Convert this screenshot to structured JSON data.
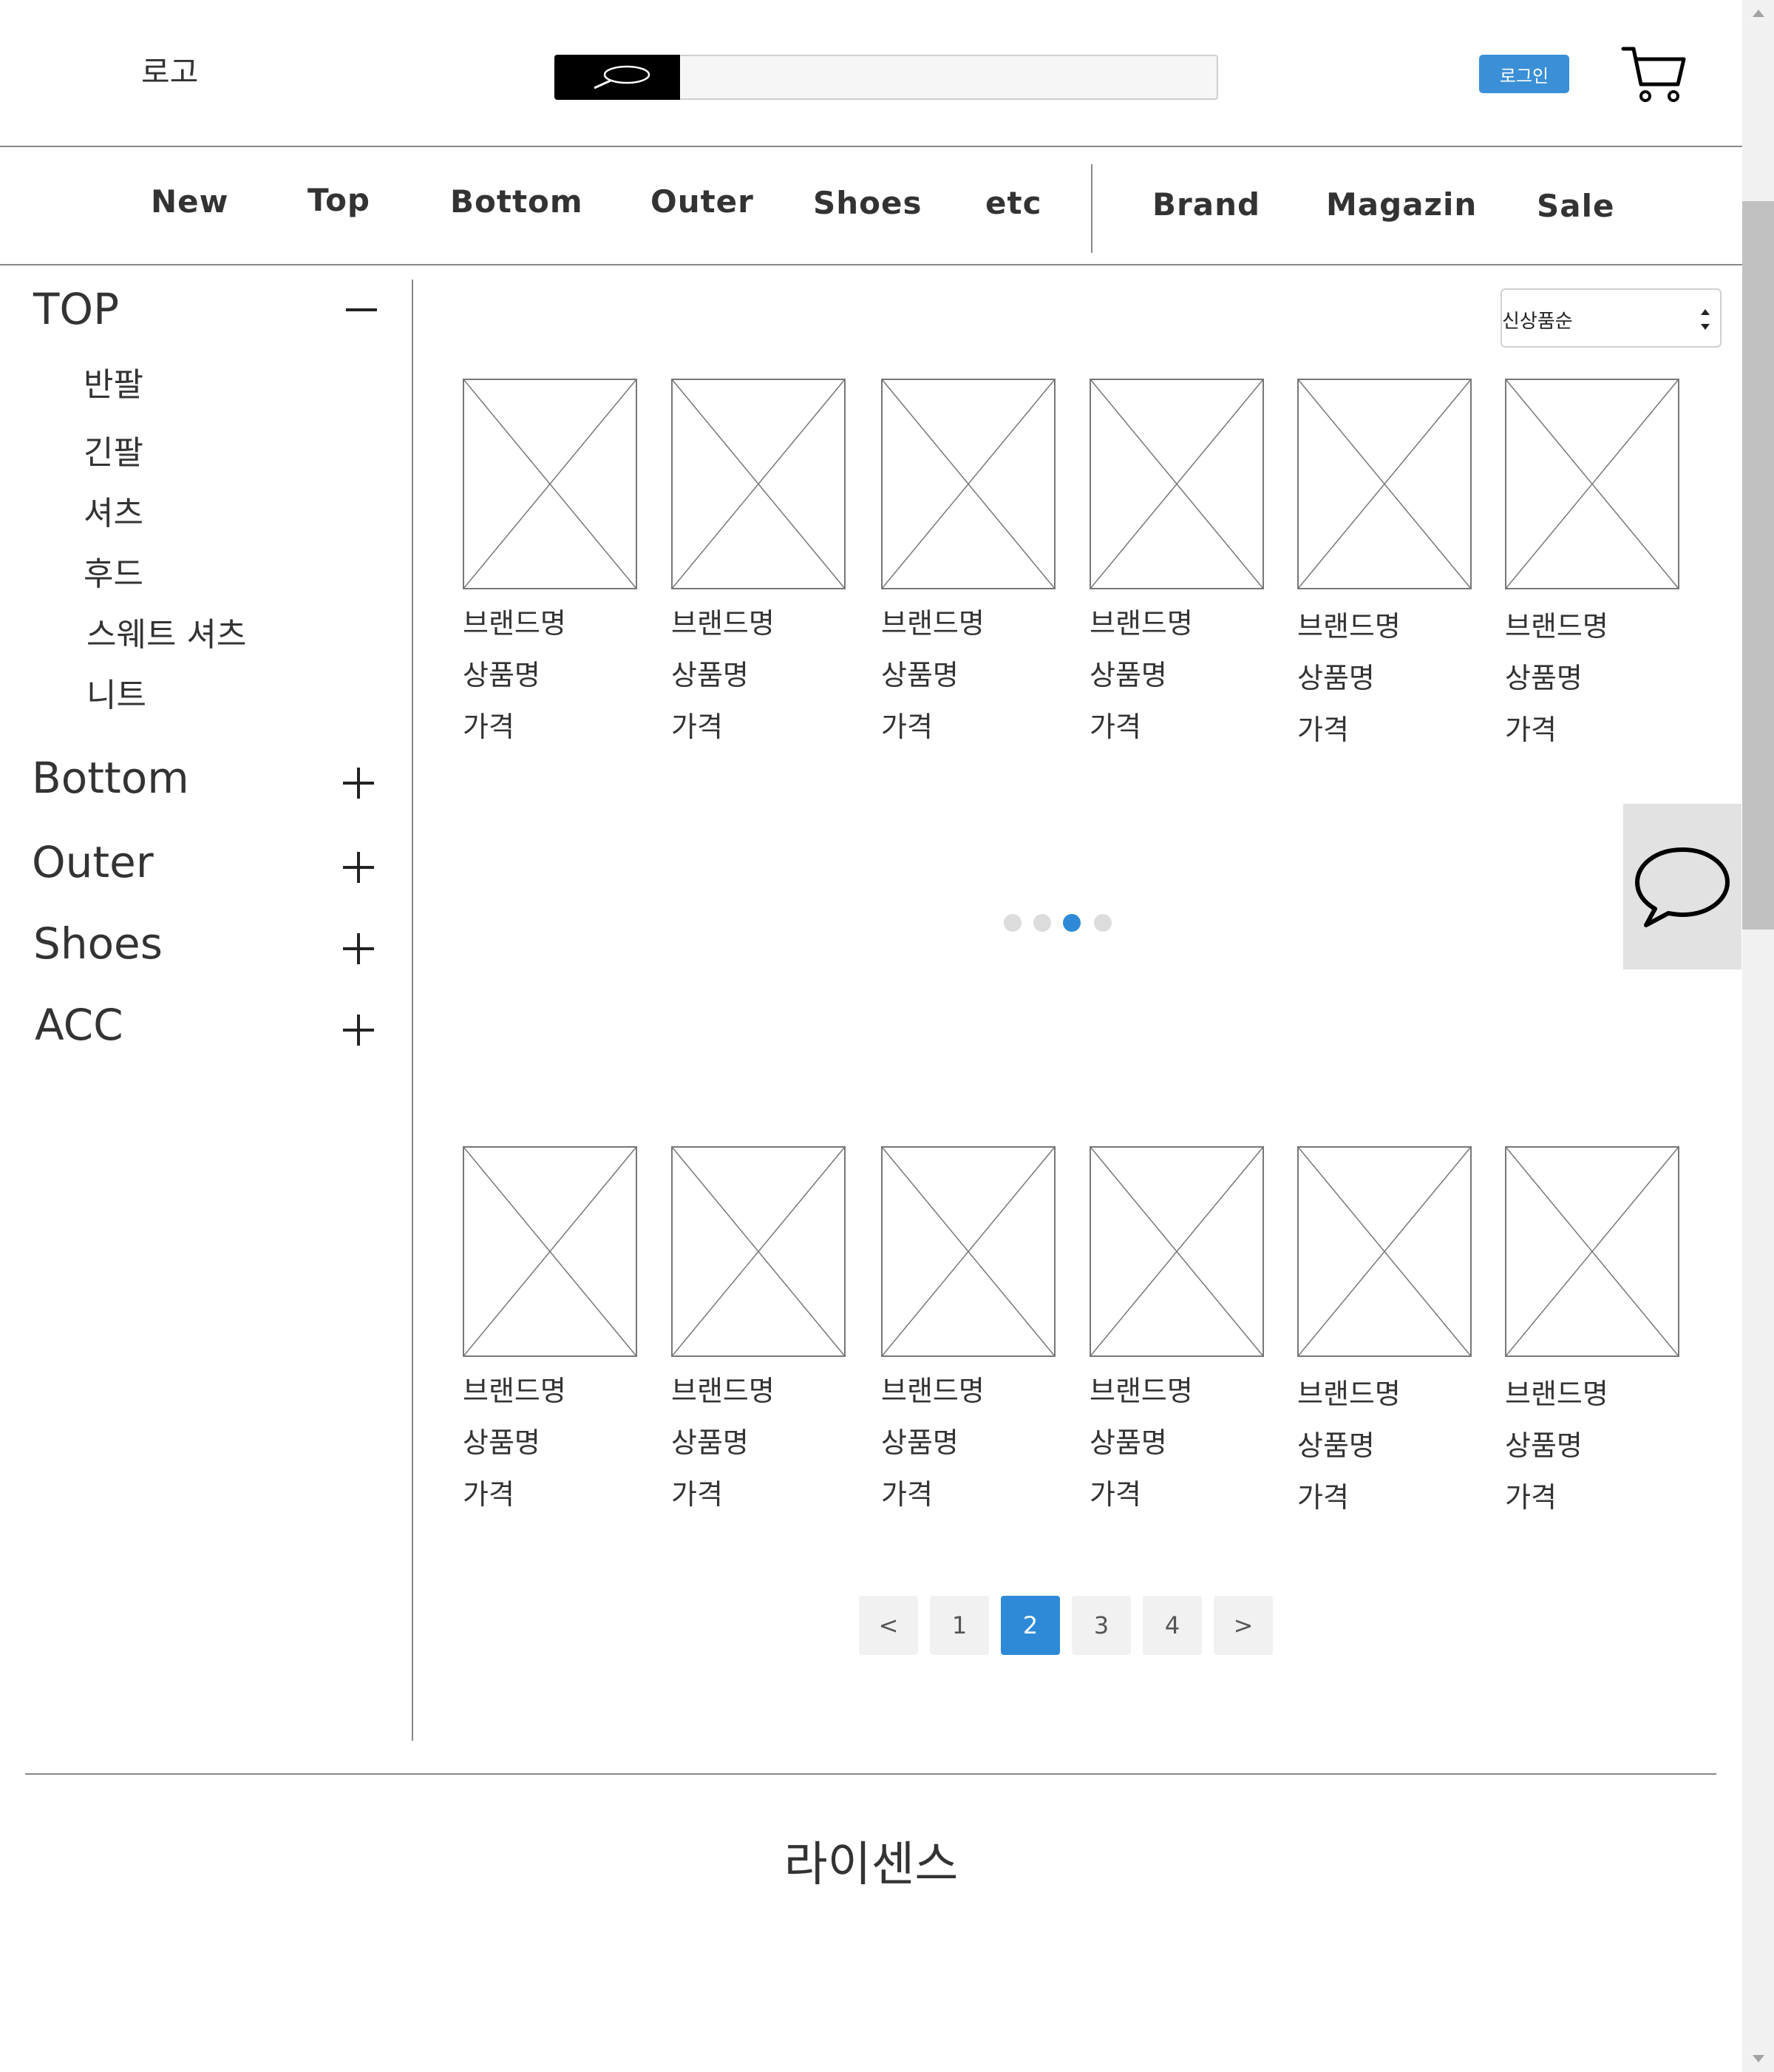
{
  "header": {
    "logo": "로고",
    "search_placeholder": "",
    "login_label": "로그인"
  },
  "nav": {
    "items": [
      "New",
      "Top",
      "Bottom",
      "Outer",
      "Shoes",
      "etc",
      "Brand",
      "Magazin",
      "Sale"
    ]
  },
  "sidebar": {
    "top": {
      "title": "TOP",
      "expanded": true,
      "sub_items": [
        "반팔",
        "긴팔",
        "셔츠",
        "후드",
        "스웨트 셔츠",
        "니트"
      ]
    },
    "categories": [
      "Bottom",
      "Outer",
      "Shoes",
      "ACC"
    ]
  },
  "sort": {
    "selected": "신상품순"
  },
  "products": {
    "row1": [
      {
        "brand": "브랜드명",
        "name": "상품명",
        "price": "가격"
      },
      {
        "brand": "브랜드명",
        "name": "상품명",
        "price": "가격"
      },
      {
        "brand": "브랜드명",
        "name": "상품명",
        "price": "가격"
      },
      {
        "brand": "브랜드명",
        "name": "상품명",
        "price": "가격"
      },
      {
        "brand": "브랜드명",
        "name": "상품명",
        "price": "가격"
      },
      {
        "brand": "브랜드명",
        "name": "상품명",
        "price": "가격"
      }
    ],
    "row2": [
      {
        "brand": "브랜드명",
        "name": "상품명",
        "price": "가격"
      },
      {
        "brand": "브랜드명",
        "name": "상품명",
        "price": "가격"
      },
      {
        "brand": "브랜드명",
        "name": "상품명",
        "price": "가격"
      },
      {
        "brand": "브랜드명",
        "name": "상품명",
        "price": "가격"
      },
      {
        "brand": "브랜드명",
        "name": "상품명",
        "price": "가격"
      },
      {
        "brand": "브랜드명",
        "name": "상품명",
        "price": "가격"
      }
    ]
  },
  "carousel": {
    "dot_count": 4,
    "active_index": 2
  },
  "pagination": {
    "prev": "<",
    "pages": [
      "1",
      "2",
      "3",
      "4"
    ],
    "current": "2",
    "next": ">"
  },
  "footer": {
    "license": "라이센스"
  },
  "icons": {
    "search": "search-icon",
    "cart": "cart-icon",
    "chat": "chat-bubble-icon",
    "collapse": "minus-icon",
    "expand": "plus-icon"
  },
  "colors": {
    "accent": "#2e8ad6",
    "login_button": "#3b8fd6",
    "search_button": "#000000"
  }
}
